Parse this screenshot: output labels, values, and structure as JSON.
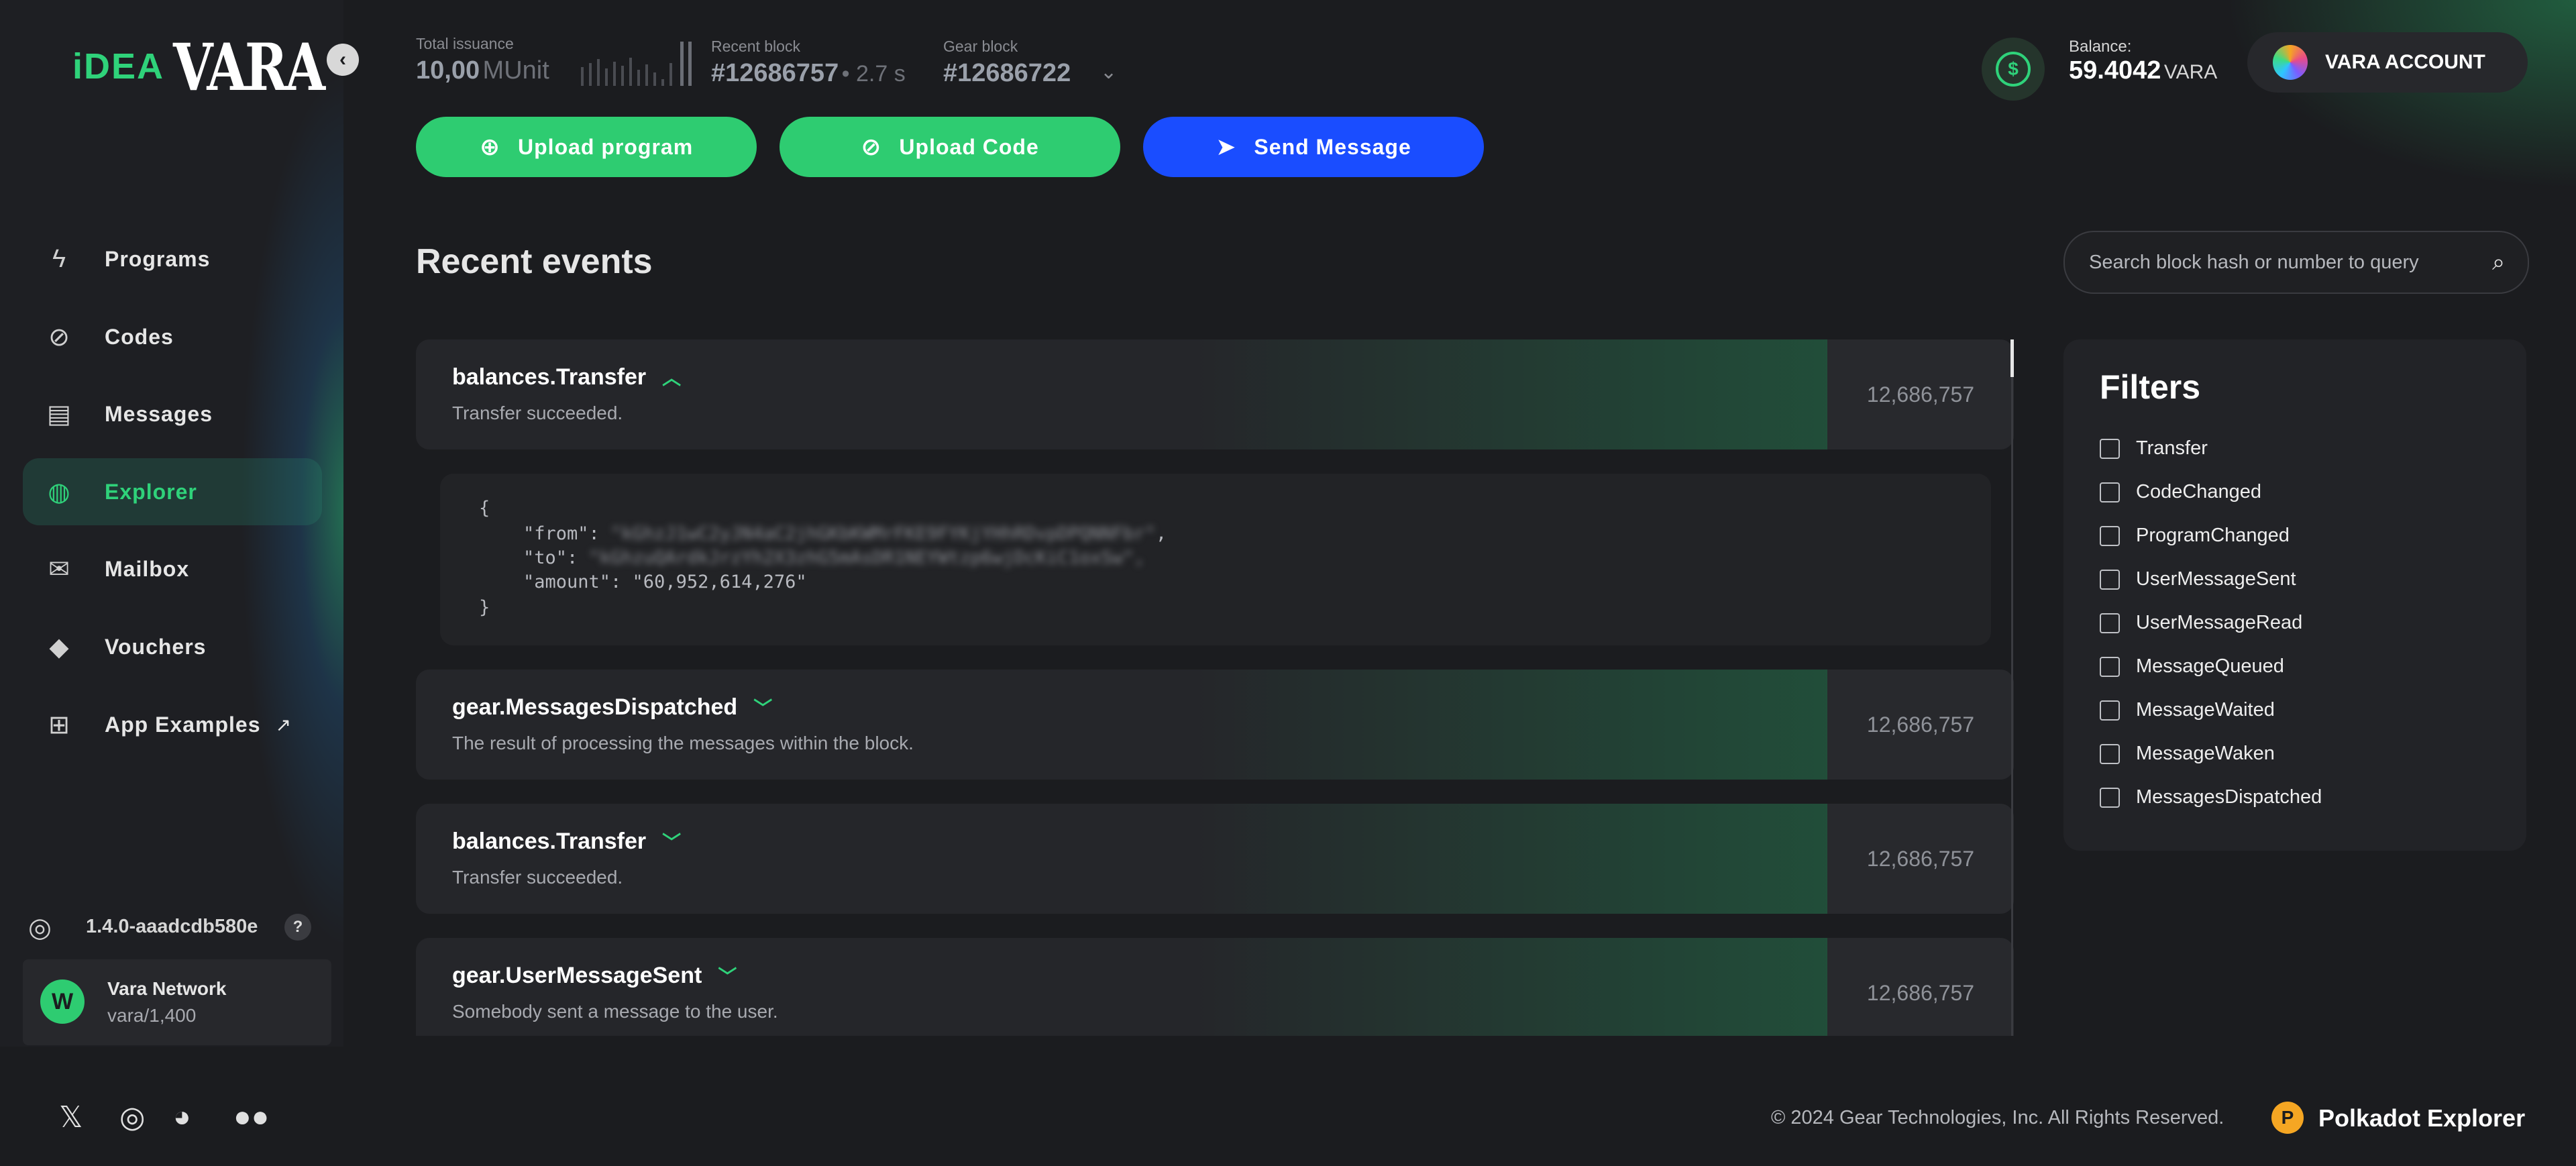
{
  "brand": {
    "idea": "iDEA",
    "vara": "VARA"
  },
  "header": {
    "total_issuance_label": "Total issuance",
    "total_issuance_value": "10,00",
    "total_issuance_unit": "MUnit",
    "recent_block_label": "Recent block",
    "recent_block_value": "#12686757",
    "recent_block_time": "• 2.7 s",
    "gear_block_label": "Gear block",
    "gear_block_value": "#12686722",
    "balance_label": "Balance:",
    "balance_value": "59.4042",
    "balance_unit": "VARA",
    "account_label": "VARA ACCOUNT"
  },
  "actions": {
    "upload_program": "Upload program",
    "upload_code": "Upload Code",
    "send_message": "Send Message"
  },
  "sidebar": {
    "items": [
      {
        "label": "Programs",
        "icon": "bolt-icon"
      },
      {
        "label": "Codes",
        "icon": "code-icon"
      },
      {
        "label": "Messages",
        "icon": "message-icon"
      },
      {
        "label": "Explorer",
        "icon": "globe-icon",
        "active": true
      },
      {
        "label": "Mailbox",
        "icon": "mail-icon"
      },
      {
        "label": "Vouchers",
        "icon": "tag-icon"
      },
      {
        "label": "App Examples",
        "icon": "apps-icon"
      }
    ],
    "version": "1.4.0-aaadcdb580e",
    "help": "?",
    "network_name": "Vara Network",
    "network_spec": "vara/1,400"
  },
  "main": {
    "title": "Recent events",
    "search_placeholder": "Search block hash or number to query",
    "events": [
      {
        "title": "balances.Transfer",
        "desc": "Transfer succeeded.",
        "block": "12,686,757",
        "expanded": true
      },
      {
        "title": "gear.MessagesDispatched",
        "desc": "The result of processing the messages within the block.",
        "block": "12,686,757"
      },
      {
        "title": "balances.Transfer",
        "desc": "Transfer succeeded.",
        "block": "12,686,757"
      },
      {
        "title": "gear.UserMessageSent",
        "desc": "Somebody sent a message to the user.",
        "block": "12,686,757"
      }
    ],
    "json": {
      "open": "{",
      "from_key": "\"from\": ",
      "to_key": "\"to\": ",
      "amount_line": "\"amount\": \"60,952,614,276\"",
      "close": "}"
    }
  },
  "filters": {
    "title": "Filters",
    "items": [
      "Transfer",
      "CodeChanged",
      "ProgramChanged",
      "UserMessageSent",
      "UserMessageRead",
      "MessageQueued",
      "MessageWaited",
      "MessageWaken",
      "MessagesDispatched"
    ]
  },
  "footer": {
    "copyright": "© 2024 Gear Technologies, Inc. All Rights Reserved.",
    "polkadot_explorer": "Polkadot Explorer"
  },
  "colors": {
    "accent_green": "#2fd27a",
    "button_green": "#2ecc71",
    "button_blue": "#1a4dff",
    "background": "#1b1c1f"
  }
}
